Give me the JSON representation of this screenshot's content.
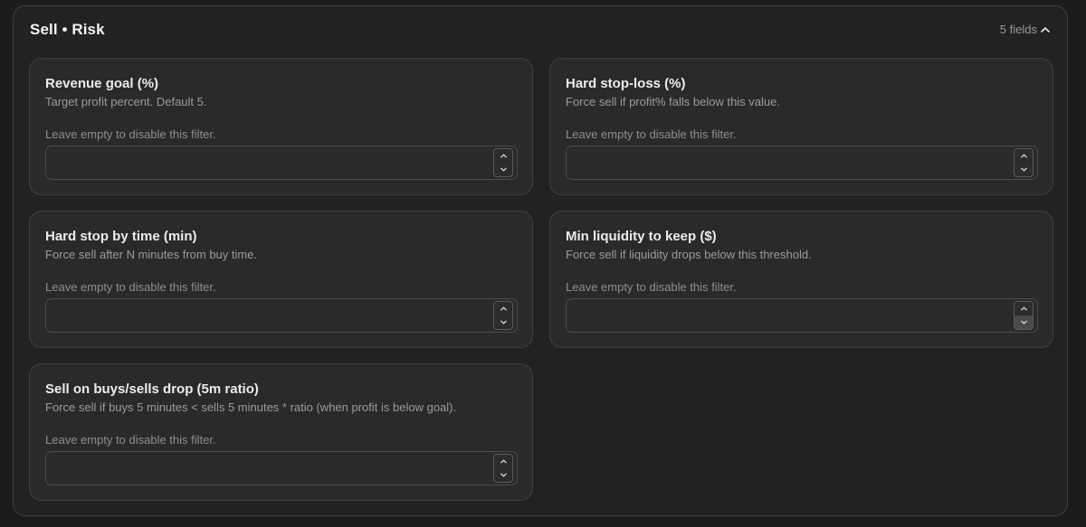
{
  "panel": {
    "title": "Sell • Risk",
    "fields_count": "5 fields",
    "collapse_icon": "chevron-up-icon"
  },
  "fields": [
    {
      "title": "Revenue goal (%)",
      "description": "Target profit percent. Default 5.",
      "hint": "Leave empty to disable this filter.",
      "value": "",
      "placeholder": ""
    },
    {
      "title": "Hard stop-loss (%)",
      "description": "Force sell if profit% falls below this value.",
      "hint": "Leave empty to disable this filter.",
      "value": "",
      "placeholder": ""
    },
    {
      "title": "Hard stop by time (min)",
      "description": "Force sell after N minutes from buy time.",
      "hint": "Leave empty to disable this filter.",
      "value": "",
      "placeholder": ""
    },
    {
      "title": "Min liquidity to keep ($)",
      "description": "Force sell if liquidity drops below this threshold.",
      "hint": "Leave empty to disable this filter.",
      "value": "",
      "placeholder": ""
    },
    {
      "title": "Sell on buys/sells drop (5m ratio)",
      "description": "Force sell if buys 5 minutes < sells 5 minutes * ratio (when profit is below goal).",
      "hint": "Leave empty to disable this filter.",
      "value": "",
      "placeholder": ""
    }
  ],
  "icons": {
    "step_up": "chevron-up-icon",
    "step_down": "chevron-down-icon"
  },
  "colors": {
    "background": "#1c1c1c",
    "panel": "#222222",
    "card": "#2a2a2a",
    "title_text": "#f2f2f2",
    "muted_text": "#9b9b9b"
  }
}
